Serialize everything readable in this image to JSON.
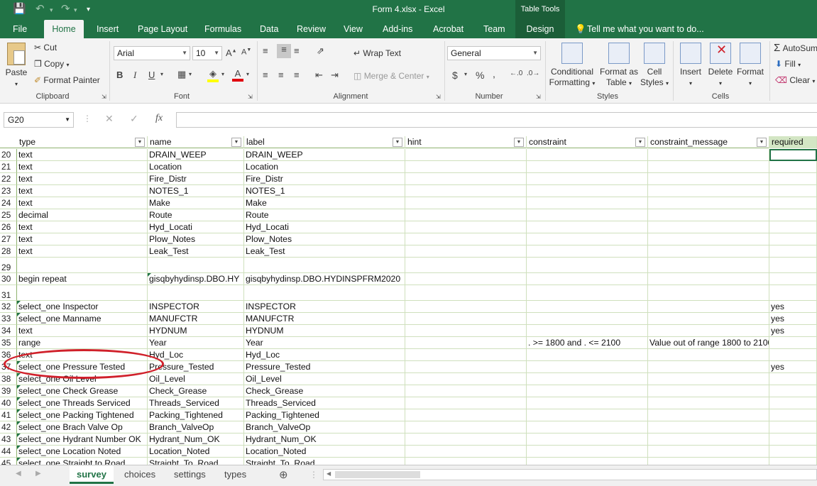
{
  "titlebar": {
    "title": "Form 4.xlsx - Excel",
    "context_group": "Table Tools",
    "save_icon": "save-icon",
    "undo_icon": "undo-icon",
    "redo_icon": "redo-icon"
  },
  "tabs": [
    "File",
    "Home",
    "Insert",
    "Page Layout",
    "Formulas",
    "Data",
    "Review",
    "View",
    "Add-ins",
    "Acrobat",
    "Team",
    "Design"
  ],
  "active_tab": "Home",
  "tell_me": "Tell me what you want to do...",
  "ribbon": {
    "clipboard": {
      "paste": "Paste",
      "cut": "Cut",
      "copy": "Copy",
      "format_painter": "Format Painter",
      "label": "Clipboard"
    },
    "font": {
      "name": "Arial",
      "size": "10",
      "label": "Font",
      "bold": "B",
      "italic": "I",
      "underline": "U"
    },
    "alignment": {
      "wrap_text": "Wrap Text",
      "merge_center": "Merge & Center",
      "label": "Alignment"
    },
    "number": {
      "format": "General",
      "label": "Number"
    },
    "styles": {
      "conditional": "Conditional",
      "conditional2": "Formatting",
      "format_as": "Format as",
      "format_as2": "Table",
      "cell": "Cell",
      "cell2": "Styles",
      "label": "Styles"
    },
    "cells": {
      "insert": "Insert",
      "delete": "Delete",
      "format": "Format",
      "label": "Cells"
    },
    "editing": {
      "autosum": "AutoSum",
      "fill": "Fill",
      "clear": "Clear"
    }
  },
  "formula_bar": {
    "namebox": "G20",
    "fx": "fx",
    "value": ""
  },
  "columns": [
    "type",
    "name",
    "label",
    "hint",
    "constraint",
    "constraint_message",
    "required"
  ],
  "rows": [
    {
      "n": "20",
      "c": [
        "text",
        "DRAIN_WEEP",
        "DRAIN_WEEP",
        "",
        "",
        "",
        ""
      ]
    },
    {
      "n": "21",
      "c": [
        "text",
        "Location",
        "Location",
        "",
        "",
        "",
        ""
      ]
    },
    {
      "n": "22",
      "c": [
        "text",
        "Fire_Distr",
        "Fire_Distr",
        "",
        "",
        "",
        ""
      ]
    },
    {
      "n": "23",
      "c": [
        "text",
        "NOTES_1",
        "NOTES_1",
        "",
        "",
        "",
        ""
      ]
    },
    {
      "n": "24",
      "c": [
        "text",
        "Make",
        "Make",
        "",
        "",
        "",
        ""
      ]
    },
    {
      "n": "25",
      "c": [
        "decimal",
        "Route",
        "Route",
        "",
        "",
        "",
        ""
      ]
    },
    {
      "n": "26",
      "c": [
        "text",
        "Hyd_Locati",
        "Hyd_Locati",
        "",
        "",
        "",
        ""
      ]
    },
    {
      "n": "27",
      "c": [
        "text",
        "Plow_Notes",
        "Plow_Notes",
        "",
        "",
        "",
        ""
      ]
    },
    {
      "n": "28",
      "c": [
        "text",
        "Leak_Test",
        "Leak_Test",
        "",
        "",
        "",
        ""
      ]
    },
    {
      "n": "29",
      "c": [
        "",
        "",
        "",
        "",
        "",
        "",
        ""
      ]
    },
    {
      "n": "30",
      "c": [
        "begin repeat",
        "gisqbyhydinsp.DBO.HY",
        "gisqbyhydinsp.DBO.HYDINSPFRM2020",
        "",
        "",
        "",
        ""
      ]
    },
    {
      "n": "31",
      "c": [
        "",
        "",
        "",
        "",
        "",
        "",
        ""
      ]
    },
    {
      "n": "32",
      "c": [
        "select_one Inspector",
        "INSPECTOR",
        "INSPECTOR",
        "",
        "",
        "",
        "yes"
      ]
    },
    {
      "n": "33",
      "c": [
        "select_one Manname",
        "MANUFCTR",
        "MANUFCTR",
        "",
        "",
        "",
        "yes"
      ]
    },
    {
      "n": "34",
      "c": [
        "text",
        "HYDNUM",
        "HYDNUM",
        "",
        "",
        "",
        "yes"
      ]
    },
    {
      "n": "35",
      "c": [
        "range",
        "Year",
        "Year",
        "",
        ". >= 1800 and . <= 2100",
        "Value out of range 1800 to 2100",
        ""
      ]
    },
    {
      "n": "36",
      "c": [
        "text",
        "Hyd_Loc",
        "Hyd_Loc",
        "",
        "",
        "",
        ""
      ]
    },
    {
      "n": "37",
      "c": [
        "select_one Pressure Tested",
        "Pressure_Tested",
        "Pressure_Tested",
        "",
        "",
        "",
        "yes"
      ]
    },
    {
      "n": "38",
      "c": [
        "select_one Oil Level",
        "Oil_Level",
        "Oil_Level",
        "",
        "",
        "",
        ""
      ]
    },
    {
      "n": "39",
      "c": [
        "select_one Check Grease",
        "Check_Grease",
        "Check_Grease",
        "",
        "",
        "",
        ""
      ]
    },
    {
      "n": "40",
      "c": [
        "select_one Threads Serviced",
        "Threads_Serviced",
        "Threads_Serviced",
        "",
        "",
        "",
        ""
      ]
    },
    {
      "n": "41",
      "c": [
        "select_one Packing Tightened",
        "Packing_Tightened",
        "Packing_Tightened",
        "",
        "",
        "",
        ""
      ]
    },
    {
      "n": "42",
      "c": [
        "select_one Brach Valve Op",
        "Branch_ValveOp",
        "Branch_ValveOp",
        "",
        "",
        "",
        ""
      ]
    },
    {
      "n": "43",
      "c": [
        "select_one Hydrant Number OK",
        "Hydrant_Num_OK",
        "Hydrant_Num_OK",
        "",
        "",
        "",
        ""
      ]
    },
    {
      "n": "44",
      "c": [
        "select_one Location Noted",
        "Location_Noted",
        "Location_Noted",
        "",
        "",
        "",
        ""
      ]
    },
    {
      "n": "45",
      "c": [
        "select_one Straight to Road",
        "Straight_To_Road",
        "Straight_To_Road",
        "",
        "",
        "",
        ""
      ]
    }
  ],
  "sheets": [
    "survey",
    "choices",
    "settings",
    "types"
  ],
  "active_sheet": "survey",
  "colors": {
    "excel_green": "#217346",
    "highlight_ellipse": "#d0202a"
  }
}
